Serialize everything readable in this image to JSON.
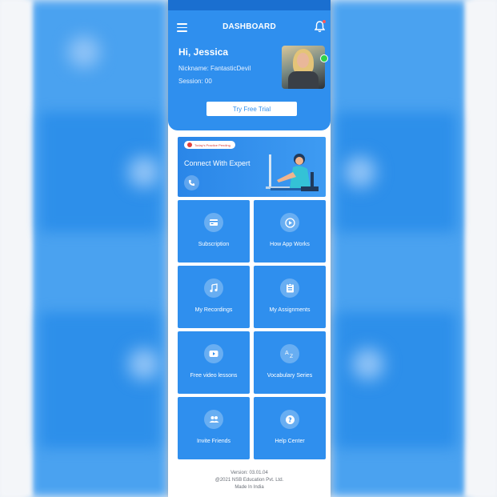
{
  "header": {
    "title": "DASHBOARD",
    "greeting": "Hi, Jessica",
    "nickname": "Nickname: FantasticDevil",
    "session": "Session: 00",
    "trial_button": "Try Free Trial",
    "colors": {
      "primary": "#2f8fee",
      "status_bar": "#1a6fd0",
      "online": "#2fd24a"
    }
  },
  "expert_card": {
    "badge": "Today's Practice Pending",
    "title": "Connect With Expert"
  },
  "tiles": [
    {
      "label": "Subscription",
      "icon": "subscription-icon"
    },
    {
      "label": "How App Works",
      "icon": "play-icon"
    },
    {
      "label": "My Recordings",
      "icon": "music-note-icon"
    },
    {
      "label": "My Assignments",
      "icon": "clipboard-icon"
    },
    {
      "label": "Free video lessons",
      "icon": "video-icon"
    },
    {
      "label": "Vocabulary Series",
      "icon": "az-icon"
    },
    {
      "label": "Invite Friends",
      "icon": "people-icon"
    },
    {
      "label": "Help Center",
      "icon": "help-icon"
    }
  ],
  "footer": {
    "version": "Version: 03.01.04",
    "copyright": "@2021 NSB Education Pvt. Ltd.",
    "made_in": "Made In India"
  }
}
